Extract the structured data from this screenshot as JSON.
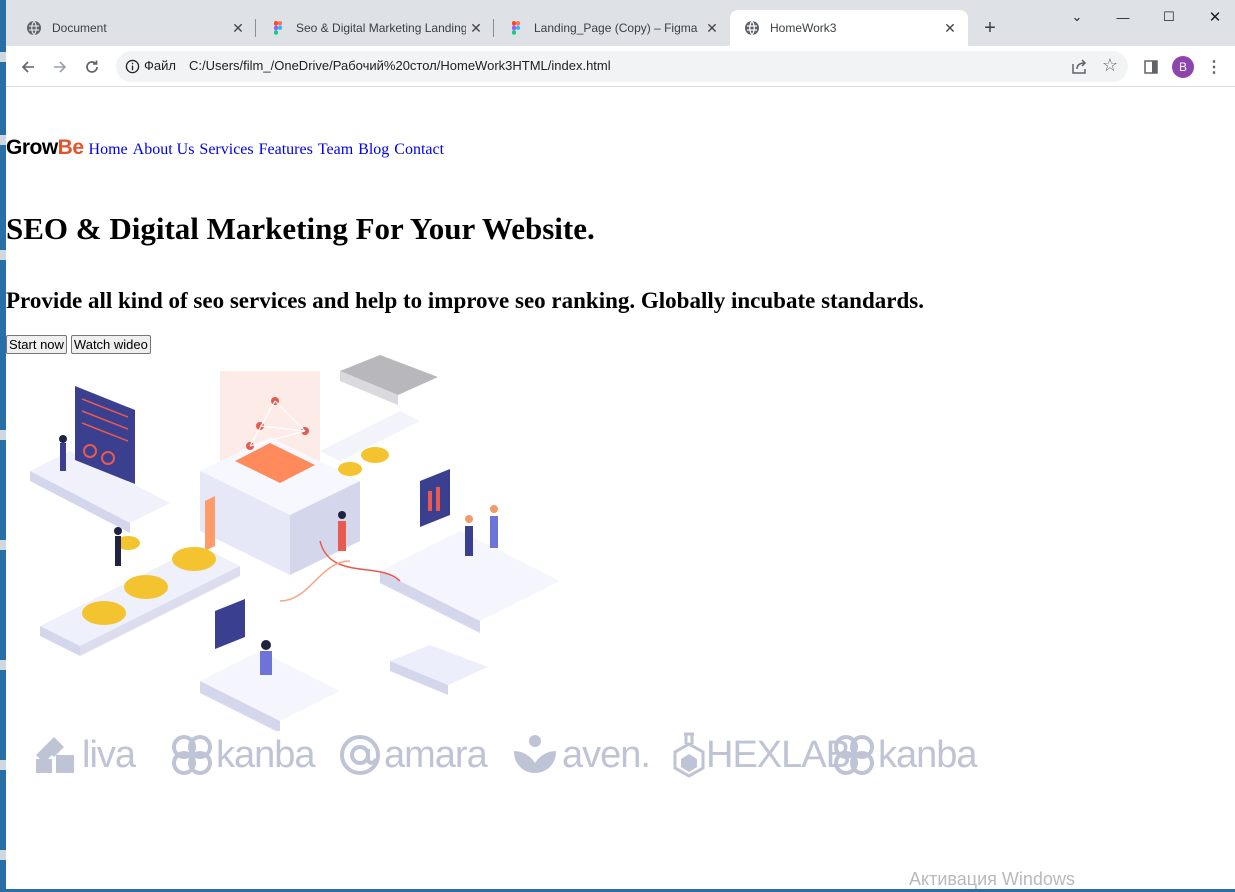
{
  "browser": {
    "tabs": [
      {
        "title": "Document",
        "icon": "globe-icon"
      },
      {
        "title": "Seo & Digital Marketing Landing",
        "icon": "figma-icon"
      },
      {
        "title": "Landing_Page (Copy) – Figma",
        "icon": "figma-icon"
      },
      {
        "title": "HomeWork3",
        "icon": "globe-icon",
        "active": true
      }
    ],
    "address": {
      "file_label": "Файл",
      "url": "C:/Users/film_/OneDrive/Рабочий%20стол/HomeWork3HTML/index.html"
    },
    "profile_initial": "B"
  },
  "page": {
    "logo": {
      "part1": "Grow",
      "part2": "Be"
    },
    "nav": [
      "Home",
      "About Us",
      "Services",
      "Features",
      "Team",
      "Blog",
      "Contact"
    ],
    "headline": "SEO & Digital Marketing For Your Website.",
    "subheadline": "Provide all kind of seo services and help to improve seo ranking. Globally incubate standards.",
    "buttons": {
      "start": "Start now",
      "watch": "Watch wideo"
    },
    "partner_logos": [
      "liva",
      "kanba",
      "amara",
      "aven.",
      "HEXLAB",
      "kanba"
    ]
  },
  "os": {
    "watermark": "Активация Windows"
  },
  "colors": {
    "accent": "#e2542c",
    "link": "#0000ee",
    "logo_grey": "#bfc3d6",
    "tab_bar": "#dee1e6"
  }
}
